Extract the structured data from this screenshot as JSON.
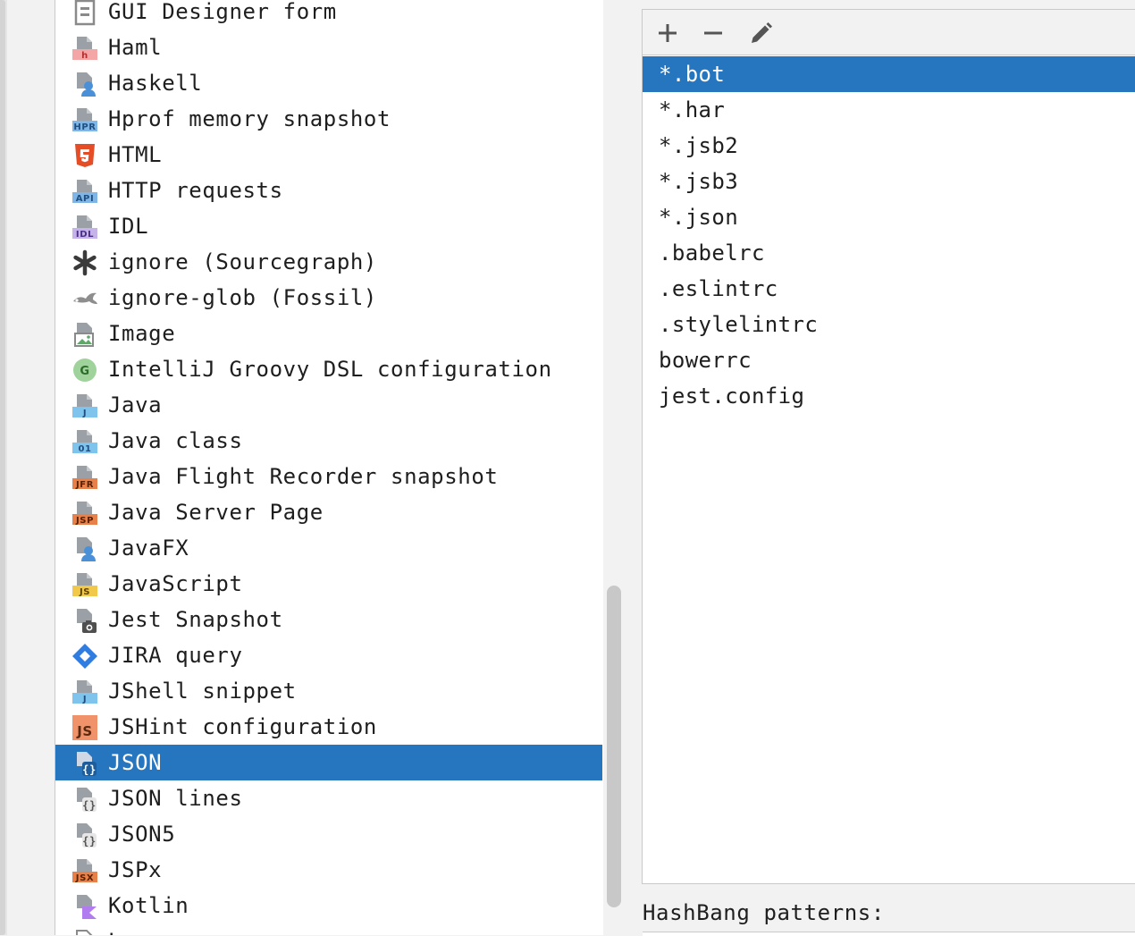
{
  "file_types": {
    "items": [
      {
        "label": "GUI Designer form",
        "icon": "gui-designer-form-icon",
        "selected": false
      },
      {
        "label": "Haml",
        "icon": "haml-icon",
        "selected": false
      },
      {
        "label": "Haskell",
        "icon": "haskell-icon",
        "selected": false
      },
      {
        "label": "Hprof memory snapshot",
        "icon": "hprof-icon",
        "selected": false
      },
      {
        "label": "HTML",
        "icon": "html5-icon",
        "selected": false
      },
      {
        "label": "HTTP requests",
        "icon": "api-file-icon",
        "selected": false
      },
      {
        "label": "IDL",
        "icon": "idl-file-icon",
        "selected": false
      },
      {
        "label": "ignore (Sourcegraph)",
        "icon": "asterisk-icon",
        "selected": false
      },
      {
        "label": "ignore-glob (Fossil)",
        "icon": "fossil-icon",
        "selected": false
      },
      {
        "label": "Image",
        "icon": "image-file-icon",
        "selected": false
      },
      {
        "label": "IntelliJ Groovy DSL configuration",
        "icon": "groovy-circle-icon",
        "selected": false
      },
      {
        "label": "Java",
        "icon": "java-file-icon",
        "selected": false
      },
      {
        "label": "Java class",
        "icon": "java-class-icon",
        "selected": false
      },
      {
        "label": "Java Flight Recorder snapshot",
        "icon": "jfr-file-icon",
        "selected": false
      },
      {
        "label": "Java Server Page",
        "icon": "jsp-file-icon",
        "selected": false
      },
      {
        "label": "JavaFX",
        "icon": "javafx-icon",
        "selected": false
      },
      {
        "label": "JavaScript",
        "icon": "javascript-file-icon",
        "selected": false
      },
      {
        "label": "Jest Snapshot",
        "icon": "jest-snapshot-icon",
        "selected": false
      },
      {
        "label": "JIRA query",
        "icon": "jira-diamond-icon",
        "selected": false
      },
      {
        "label": "JShell snippet",
        "icon": "jshell-file-icon",
        "selected": false
      },
      {
        "label": "JSHint configuration",
        "icon": "jshint-icon",
        "selected": false
      },
      {
        "label": "JSON",
        "icon": "json-file-icon",
        "selected": true
      },
      {
        "label": "JSON lines",
        "icon": "json-file-icon",
        "selected": false
      },
      {
        "label": "JSON5",
        "icon": "json-file-icon",
        "selected": false
      },
      {
        "label": "JSPx",
        "icon": "jsx-file-icon",
        "selected": false
      },
      {
        "label": "Kotlin",
        "icon": "kotlin-file-icon",
        "selected": false
      },
      {
        "label": "L",
        "icon": "generic-file-icon",
        "selected": false
      }
    ]
  },
  "toolbar": {
    "add_icon": "plus-icon",
    "remove_icon": "minus-icon",
    "edit_icon": "pencil-icon"
  },
  "patterns": {
    "items": [
      {
        "label": "*.bot",
        "selected": true
      },
      {
        "label": "*.har",
        "selected": false
      },
      {
        "label": "*.jsb2",
        "selected": false
      },
      {
        "label": "*.jsb3",
        "selected": false
      },
      {
        "label": "*.json",
        "selected": false
      },
      {
        "label": ".babelrc",
        "selected": false
      },
      {
        "label": ".eslintrc",
        "selected": false
      },
      {
        "label": ".stylelintrc",
        "selected": false
      },
      {
        "label": "bowerrc",
        "selected": false
      },
      {
        "label": "jest.config",
        "selected": false
      }
    ]
  },
  "hashbang": {
    "label": "HashBang patterns:"
  },
  "colors": {
    "selection": "#2675bf",
    "panel_bg": "#f2f2f2",
    "list_bg": "#ffffff",
    "border": "#c9c9c9"
  }
}
